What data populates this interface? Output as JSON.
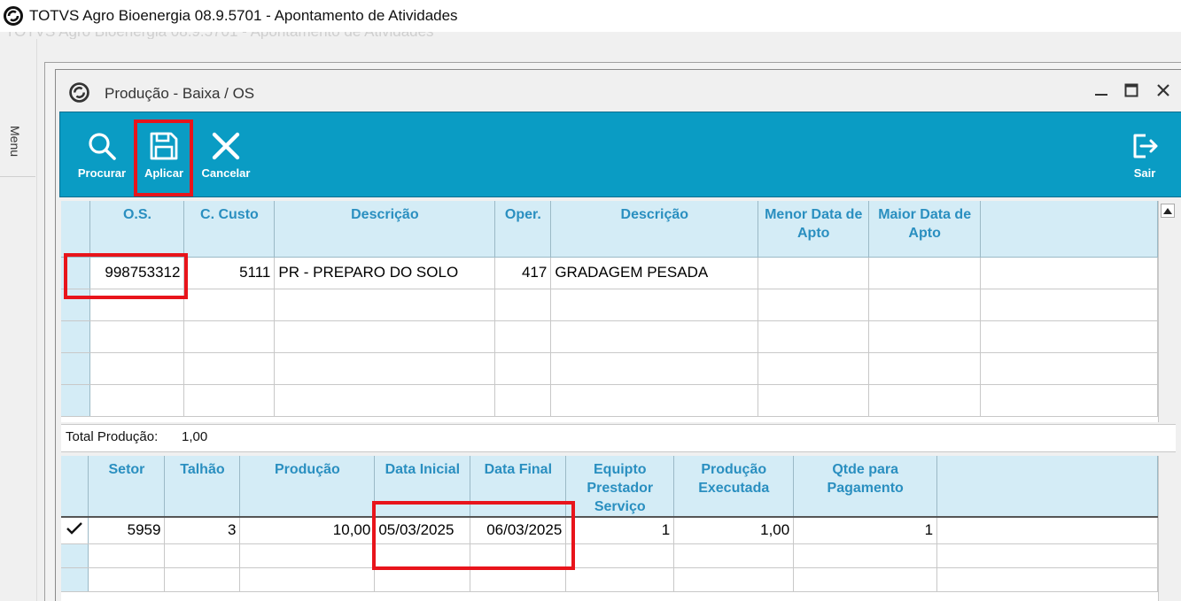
{
  "app": {
    "title": "TOTVS Agro Bioenergia 08.9.5701 - Apontamento de Atividades",
    "ghost_title": "TOTVS Agro Bioenergia 08.9.5701 - Apontamento de Atividades"
  },
  "menu": {
    "label": "Menu"
  },
  "window": {
    "title": "Produção - Baixa / OS"
  },
  "toolbar": {
    "search_label": "Procurar",
    "apply_label": "Aplicar",
    "cancel_label": "Cancelar",
    "exit_label": "Sair",
    "color": "#0a9cc4"
  },
  "os_grid": {
    "headers": [
      "O.S.",
      "C. Custo",
      "Descrição",
      "Oper.",
      "Descrição",
      "Menor Data de Apto",
      "Maior Data de Apto"
    ],
    "rows": [
      {
        "os": "998753312",
        "custo": "5111",
        "desc": "PR - PREPARO DO SOLO",
        "oper": "417",
        "desc_oper": "GRADAGEM PESADA",
        "menor": "",
        "maior": ""
      }
    ]
  },
  "total": {
    "label": "Total Produção:",
    "value": "1,00"
  },
  "prod_grid": {
    "headers": [
      "Setor",
      "Talhão",
      "Produção",
      "Data Inicial",
      "Data Final",
      "Equipto Prestador Serviço",
      "Produção Executada",
      "Qtde para Pagamento"
    ],
    "rows": [
      {
        "setor": "5959",
        "talhao": "3",
        "producao": "10,00",
        "data_inicial": "05/03/2025",
        "data_final": "06/03/2025",
        "equipto": "1",
        "executada": "1,00",
        "qtde": "1"
      }
    ]
  },
  "colors": {
    "header_bg": "#d4ecf6",
    "header_text": "#2a8fc0",
    "highlight": "#e8141b"
  }
}
